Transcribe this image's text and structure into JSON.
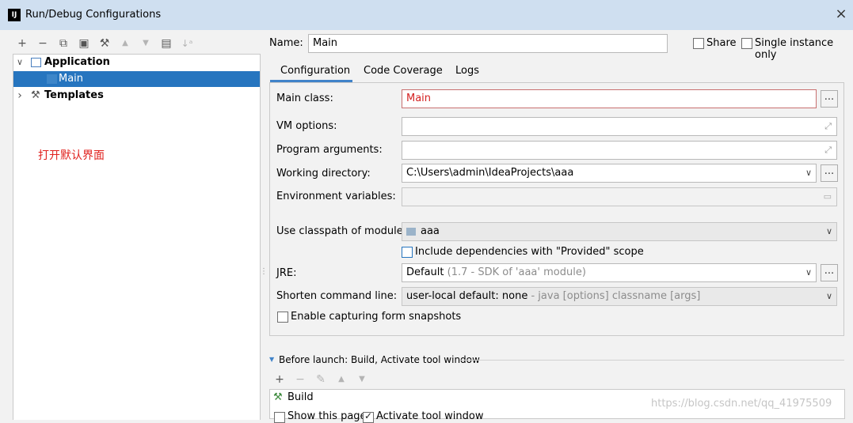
{
  "window": {
    "title": "Run/Debug Configurations",
    "app_logo": "IJ",
    "close_symbol": "×"
  },
  "left_toolbar": {
    "add": "+",
    "remove": "−",
    "copy": "⧉",
    "save": "▣",
    "edit_defaults": "⚒",
    "move_up": "▲",
    "move_down": "▼",
    "new_folder": "▤",
    "sort": "↓ᵃ"
  },
  "tree": {
    "application_label": "Application",
    "main_label": "Main",
    "templates_label": "Templates",
    "expanded_arrow": "∨",
    "collapsed_arrow": "›"
  },
  "annotation": {
    "text": "打开默认界面"
  },
  "header": {
    "name_label": "Name:",
    "name_value": "Main",
    "share_label": "Share",
    "single_instance_label": "Single instance only"
  },
  "tabs": [
    {
      "label": "Configuration"
    },
    {
      "label": "Code Coverage"
    },
    {
      "label": "Logs"
    }
  ],
  "form": {
    "main_class_label": "Main class:",
    "main_class_value": "Main",
    "vm_options_label": "VM options:",
    "program_arguments_label": "Program arguments:",
    "working_directory_label": "Working directory:",
    "working_directory_value": "C:\\Users\\admin\\IdeaProjects\\aaa",
    "environment_variables_label": "Environment variables:",
    "classpath_label": "Use classpath of module:",
    "classpath_value": "aaa",
    "include_provided_label": "Include dependencies with \"Provided\" scope",
    "jre_label": "JRE:",
    "jre_value": "Default",
    "jre_hint": "(1.7 - SDK of 'aaa' module)",
    "shorten_label": "Shorten command line:",
    "shorten_value": "user-local default: none",
    "shorten_hint": "- java [options] classname [args]",
    "snapshots_label": "Enable capturing form snapshots",
    "dots": "..."
  },
  "before_launch": {
    "title": "Before launch: Build, Activate tool window",
    "add": "+",
    "remove": "−",
    "edit": "✎",
    "up": "▲",
    "down": "▼",
    "item": "Build",
    "show_page_label": "Show this page",
    "activate_label": "Activate tool window"
  },
  "watermark": "https://blog.csdn.net/qq_41975509",
  "colors": {
    "accent": "#2675bf",
    "error_text": "#e0201c",
    "titlebar": "#cfdff0"
  }
}
